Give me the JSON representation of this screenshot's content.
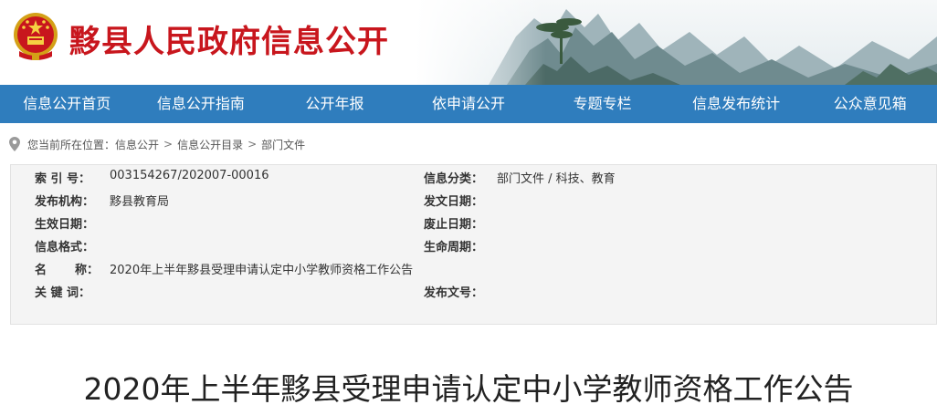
{
  "site": {
    "title": "黟县人民政府信息公开"
  },
  "nav": {
    "items": [
      "信息公开首页",
      "信息公开指南",
      "公开年报",
      "依申请公开",
      "专题专栏",
      "信息发布统计",
      "公众意见箱"
    ]
  },
  "breadcrumb": {
    "prefix": "您当前所在位置：",
    "items": [
      "信息公开",
      "信息公开目录",
      "部门文件"
    ],
    "separator": ">"
  },
  "info": {
    "index_label": "索 引 号：",
    "index_value": "003154267/202007-00016",
    "category_label": "信息分类：",
    "category_value": "部门文件 / 科技、教育",
    "org_label": "发布机构：",
    "org_value": "黟县教育局",
    "date_issued_label": "发文日期：",
    "date_issued_value": "",
    "effective_label": "生效日期：",
    "effective_value": "",
    "abolished_label": "废止日期：",
    "abolished_value": "",
    "format_label": "信息格式：",
    "format_value": "",
    "lifecycle_label": "生命周期：",
    "lifecycle_value": "",
    "name_label_a": "名",
    "name_label_b": "称：",
    "name_value": "2020年上半年黟县受理申请认定中小学教师资格工作公告",
    "keywords_label": "关 键 词：",
    "keywords_value": "",
    "doc_no_label": "发布文号：",
    "doc_no_value": ""
  },
  "document": {
    "title": "2020年上半年黟县受理申请认定中小学教师资格工作公告"
  },
  "colors": {
    "brand_red": "#c8161d",
    "nav_blue": "#2f7dbd",
    "info_bg": "#f4f4f4"
  },
  "icons": {
    "emblem": "national-emblem-icon",
    "location": "map-pin-icon"
  }
}
